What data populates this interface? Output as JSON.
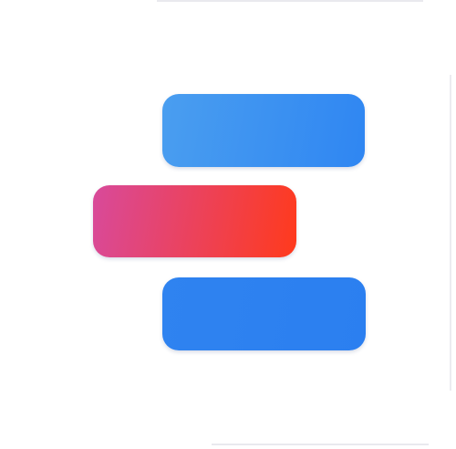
{
  "logo": {
    "icon": "stacked-bars-logo-icon",
    "bars": [
      {
        "role": "top",
        "color_start": "#4a9ef0",
        "color_end": "#2f86f2"
      },
      {
        "role": "middle",
        "color_start": "#d84a9b",
        "color_end": "#ff3a1c"
      },
      {
        "role": "bottom",
        "color_start": "#2f83f0",
        "color_end": "#2b7ff0"
      }
    ]
  },
  "colors": {
    "background": "#ffffff",
    "divider": "#e9e9ee"
  }
}
